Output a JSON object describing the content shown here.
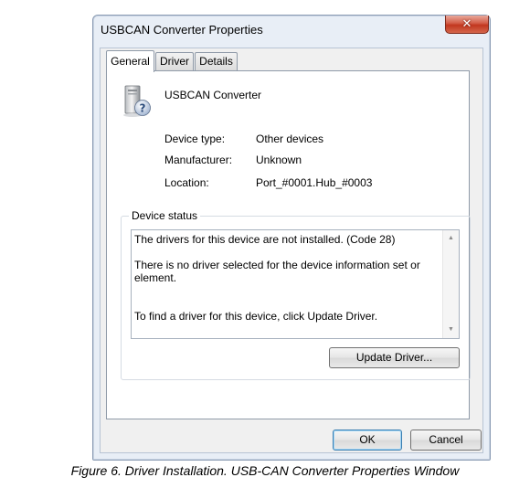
{
  "window": {
    "title": "USBCAN Converter Properties",
    "close_glyph": "✕"
  },
  "tabs": [
    {
      "label": "General",
      "active": true
    },
    {
      "label": "Driver",
      "active": false
    },
    {
      "label": "Details",
      "active": false
    }
  ],
  "device": {
    "icon": "unknown-device-icon",
    "name": "USBCAN Converter"
  },
  "properties": [
    {
      "label": "Device type:",
      "value": "Other devices"
    },
    {
      "label": "Manufacturer:",
      "value": "Unknown"
    },
    {
      "label": "Location:",
      "value": "Port_#0001.Hub_#0003"
    }
  ],
  "device_status": {
    "label": "Device status",
    "lines": [
      "The drivers for this device are not installed. (Code 28)",
      "There is no driver selected for the device information set or element.",
      "To find a driver for this device, click Update Driver."
    ]
  },
  "buttons": {
    "update_driver": "Update Driver...",
    "ok": "OK",
    "cancel": "Cancel"
  },
  "caption": "Figure 6. Driver Installation. USB-CAN Converter Properties Window",
  "colors": {
    "close_button": "#c2371f",
    "window_frame": "#e8eef6",
    "default_button_border": "#3c7fb1"
  }
}
